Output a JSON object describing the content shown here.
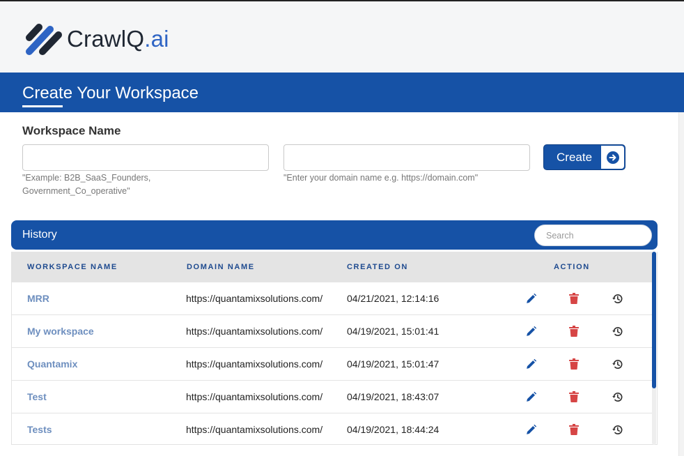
{
  "brand": {
    "name_part1": "CrawlQ",
    "name_part2": ".ai"
  },
  "banner": {
    "title": "Create Your Workspace"
  },
  "form": {
    "workspace_label": "Workspace Name",
    "workspace_value": "",
    "workspace_hint": "\"Example: B2B_SaaS_Founders, Government_Co_operative\"",
    "domain_value": "",
    "domain_hint": "\"Enter your domain name e.g. https://domain.com\"",
    "create_label": "Create"
  },
  "history": {
    "title": "History",
    "search_placeholder": "Search",
    "columns": {
      "workspace": "WORKSPACE NAME",
      "domain": "DOMAIN NAME",
      "created": "CREATED ON",
      "action": "ACTION"
    },
    "rows": [
      {
        "name": "MRR",
        "domain": "https://quantamixsolutions.com/",
        "created": "04/21/2021, 12:14:16"
      },
      {
        "name": "My workspace",
        "domain": "https://quantamixsolutions.com/",
        "created": "04/19/2021, 15:01:41"
      },
      {
        "name": "Quantamix",
        "domain": "https://quantamixsolutions.com/",
        "created": "04/19/2021, 15:01:47"
      },
      {
        "name": "Test",
        "domain": "https://quantamixsolutions.com/",
        "created": "04/19/2021, 18:43:07"
      },
      {
        "name": "Tests",
        "domain": "https://quantamixsolutions.com/",
        "created": "04/19/2021, 18:44:24"
      }
    ]
  },
  "icons": {
    "edit": "pencil-icon",
    "delete": "trash-icon",
    "history": "history-icon",
    "create": "arrow-right-circle-icon"
  },
  "colors": {
    "primary": "#1652a6",
    "delete": "#d64545",
    "link": "#6e8fbf",
    "logo_accent": "#2e64c4"
  }
}
